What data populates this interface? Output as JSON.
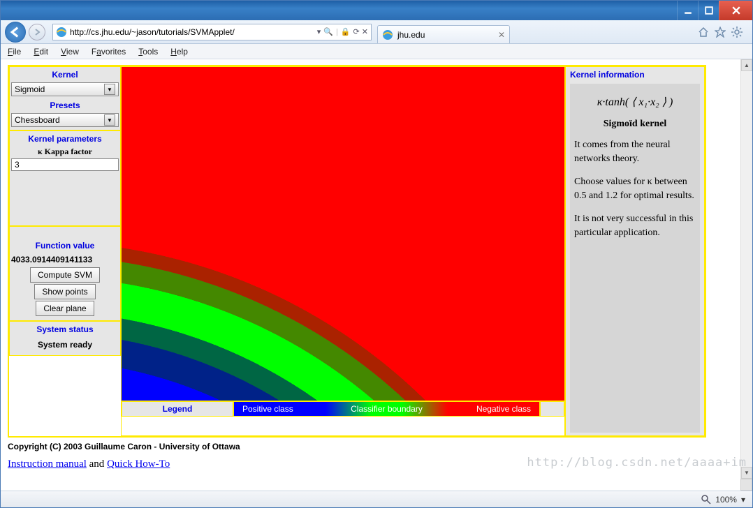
{
  "browser": {
    "url": "http://cs.jhu.edu/~jason/tutorials/SVMApplet/",
    "tab_title": "jhu.edu",
    "refresh_glyphs": "⟳  ✕",
    "security_glyph": "🔒"
  },
  "menubar": {
    "file": "File",
    "edit": "Edit",
    "view": "View",
    "favorites": "Favorites",
    "tools": "Tools",
    "help": "Help"
  },
  "sidebar": {
    "kernel_heading": "Kernel",
    "kernel_value": "Sigmoid",
    "presets_heading": "Presets",
    "presets_value": "Chessboard",
    "params_heading": "Kernel parameters",
    "kappa_label": "κ  Kappa factor",
    "kappa_value": "3",
    "fn_heading": "Function value",
    "fn_value": "4033.0914409141133",
    "btn_compute": "Compute SVM",
    "btn_show": "Show points",
    "btn_clear": "Clear plane",
    "status_heading": "System status",
    "status_text": "System ready"
  },
  "legend": {
    "heading": "Legend",
    "positive": "Positive class",
    "boundary": "Classifier boundary",
    "negative": "Negative class"
  },
  "info": {
    "heading": "Kernel information",
    "formula": "κ·tanh( ⟨ x₁·x₂ ⟩ )",
    "title": "Sigmoïd kernel",
    "p1": "It comes from the neural networks theory.",
    "p2a": "Choose values for ",
    "p2_kappa": "κ",
    "p2b": " between 0.5 and 1.2 for optimal results.",
    "p3": "It is not very successful in this particular application."
  },
  "footer": {
    "copyright": "Copyright (C) 2003 Guillaume Caron - University of Ottawa",
    "link1": "Instruction manual",
    "and": " and ",
    "link2": "Quick How-To"
  },
  "statusbar": {
    "zoom": "100%"
  },
  "watermark": "http://blog.csdn.net/aaaa+im"
}
